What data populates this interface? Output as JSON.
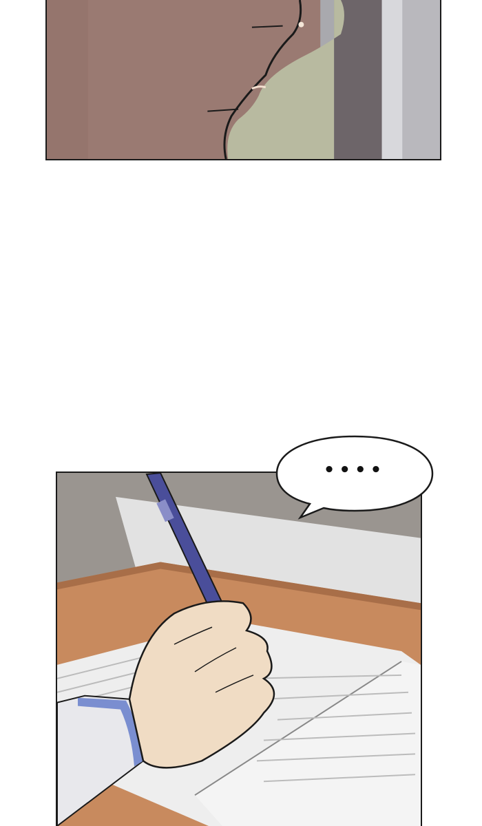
{
  "panels": [
    {
      "id": "top-panel",
      "scene": "close-up-face-profile"
    },
    {
      "id": "bottom-panel",
      "scene": "hand-writing-with-pen"
    }
  ],
  "speech_bubble": {
    "text": "••••"
  },
  "colors": {
    "background": "#ffffff",
    "panel_border": "#1a1a1a",
    "face_shadow": "#9a7a72",
    "hair": "#b8baa0",
    "wall": "#9a9590",
    "desk": "#c88a5e",
    "paper": "#eeeeee",
    "pen": "#4a4e9a",
    "skin": "#f0dcc4",
    "sleeve": "#e8e8ec",
    "cuff": "#7a8ed0"
  }
}
